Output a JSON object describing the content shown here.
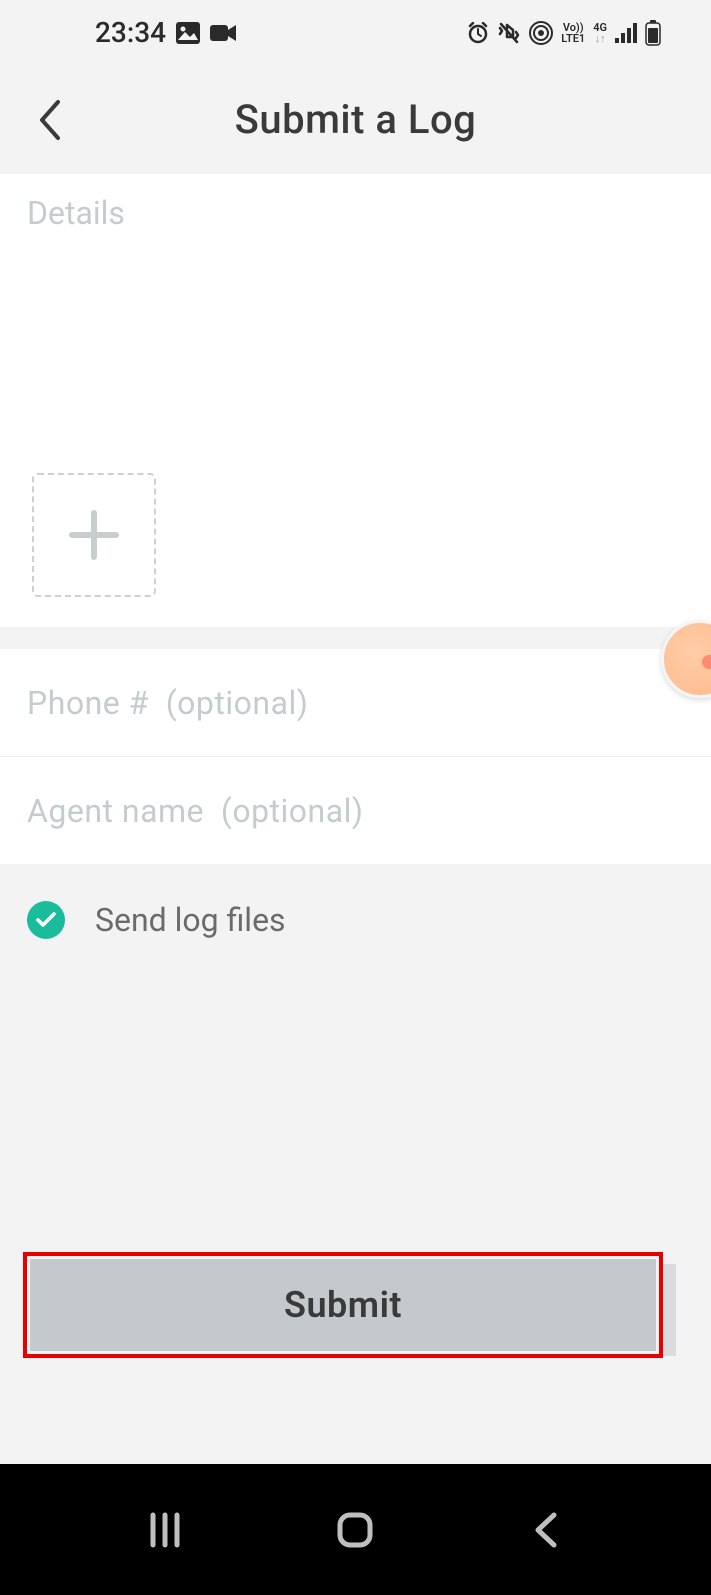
{
  "statusbar": {
    "time": "23:34"
  },
  "header": {
    "title": "Submit a Log"
  },
  "form": {
    "details_placeholder": "Details",
    "phone_placeholder": "Phone #  (optional)",
    "agent_placeholder": "Agent name  (optional)",
    "send_logs_label": "Send log files",
    "submit_label": "Submit"
  }
}
